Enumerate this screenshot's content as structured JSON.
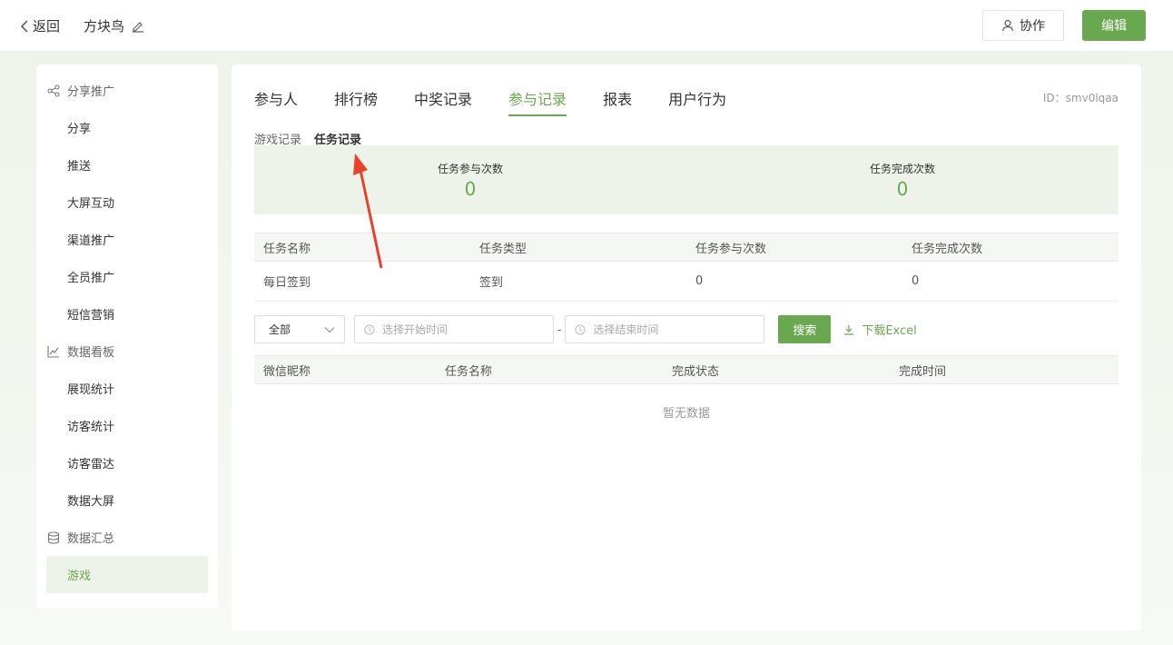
{
  "topbar": {
    "back_label": "返回",
    "title": "方块鸟",
    "collab_label": "协作",
    "edit_label": "编辑"
  },
  "sidebar": {
    "groups": [
      {
        "label": "分享推广",
        "icon": "share-icon",
        "items": [
          "分享",
          "推送",
          "大屏互动",
          "渠道推广",
          "全员推广",
          "短信营销"
        ]
      },
      {
        "label": "数据看板",
        "icon": "chart-line-icon",
        "items": [
          "展现统计",
          "访客统计",
          "访客雷达",
          "数据大屏"
        ]
      },
      {
        "label": "数据汇总",
        "icon": "database-icon",
        "items": [
          "游戏"
        ]
      }
    ],
    "active_item": "游戏"
  },
  "main": {
    "tabs": [
      "参与人",
      "排行榜",
      "中奖记录",
      "参与记录",
      "报表",
      "用户行为"
    ],
    "active_tab": "参与记录",
    "id_label": "ID：smv0lqaa",
    "subtabs": [
      "游戏记录",
      "任务记录"
    ],
    "active_subtab": "任务记录",
    "stats": [
      {
        "label": "任务参与次数",
        "value": "0"
      },
      {
        "label": "任务完成次数",
        "value": "0"
      }
    ],
    "task_table": {
      "headers": [
        "任务名称",
        "任务类型",
        "任务参与次数",
        "任务完成次数"
      ],
      "rows": [
        [
          "每日签到",
          "签到",
          "0",
          "0"
        ]
      ]
    },
    "filters": {
      "select_value": "全部",
      "start_placeholder": "选择开始时间",
      "separator": "-",
      "end_placeholder": "选择结束时间",
      "search_label": "搜索",
      "download_label": "下载Excel"
    },
    "record_table": {
      "headers": [
        "微信昵称",
        "任务名称",
        "完成状态",
        "完成时间"
      ],
      "empty_text": "暂无数据"
    }
  },
  "colors": {
    "accent": "#6aa84f",
    "annotation_arrow": "#e8412c"
  }
}
